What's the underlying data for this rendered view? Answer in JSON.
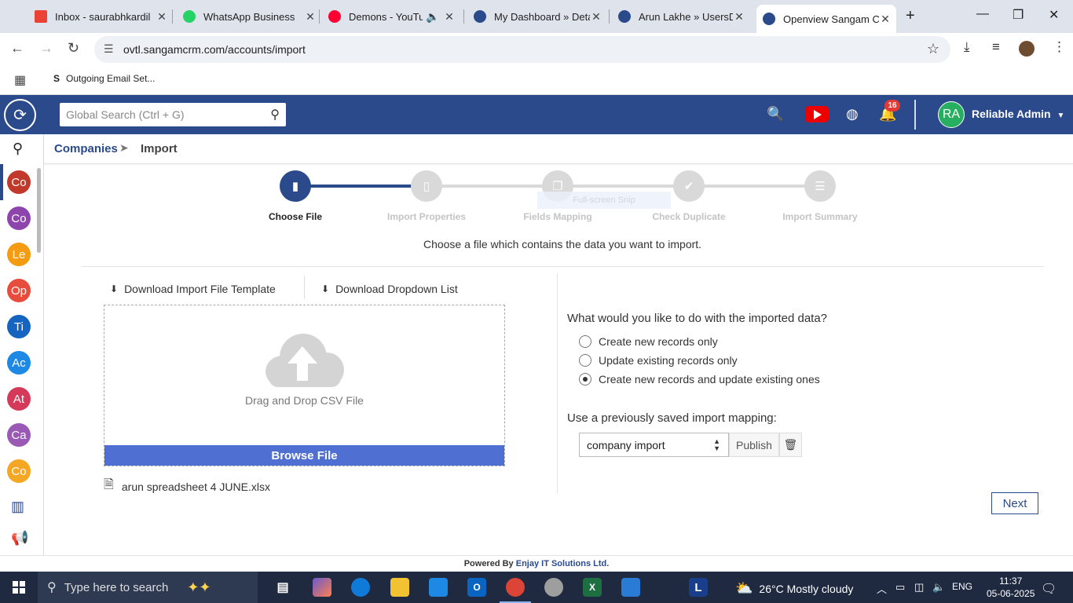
{
  "browser": {
    "tabs": [
      {
        "title": "Inbox - saurabhkardil",
        "color": "#ea4335",
        "icon": "gmail-icon"
      },
      {
        "title": "WhatsApp Business",
        "color": "#25d366",
        "icon": "whatsapp-icon"
      },
      {
        "title": "Demons - YouTube",
        "color": "#ff0033",
        "icon": "youtube-icon"
      },
      {
        "title": "My Dashboard » Deta",
        "color": "#2b4a8b",
        "icon": "crm-icon"
      },
      {
        "title": "Arun Lakhe » UsersDe",
        "color": "#2b4a8b",
        "icon": "crm-icon"
      },
      {
        "title": "Openview Sangam CR",
        "color": "#2b4a8b",
        "icon": "crm-icon"
      }
    ],
    "url": "ovtl.sangamcrm.com/accounts/import",
    "bookmark": "Outgoing Email Set..."
  },
  "header": {
    "search_placeholder": "Global Search (Ctrl + G)",
    "notification_count": "16",
    "avatar_initials": "RA",
    "user_name": "Reliable Admin"
  },
  "rail": [
    {
      "label": "Co",
      "color": "#c0392b"
    },
    {
      "label": "Co",
      "color": "#8e44ad"
    },
    {
      "label": "Le",
      "color": "#f39c12"
    },
    {
      "label": "Op",
      "color": "#e74c3c"
    },
    {
      "label": "Ti",
      "color": "#1565c0"
    },
    {
      "label": "Ac",
      "color": "#1e88e5"
    },
    {
      "label": "At",
      "color": "#d63a5a"
    },
    {
      "label": "Ca",
      "color": "#9b59b6"
    },
    {
      "label": "Co",
      "color": "#f5a623"
    }
  ],
  "breadcrumb": {
    "parent": "Companies",
    "current": "Import"
  },
  "stepper": {
    "steps": [
      "Choose File",
      "Import Properties",
      "Fields Mapping",
      "Check Duplicate",
      "Import Summary"
    ],
    "active_step": 1,
    "active_color": "#2b4a8b",
    "inactive_color": "#d9d9d9",
    "overlay_text": "Full-screen Snip"
  },
  "instruction": "Choose a file which contains the data you want to import.",
  "left": {
    "download_template": "Download Import File Template",
    "download_dropdown": "Download Dropdown List",
    "drop_text": "Drag and Drop CSV File",
    "browse_label": "Browse File",
    "file_name": "arun spreadsheet 4 JUNE.xlsx"
  },
  "right": {
    "question": "What would you like to do with the imported data?",
    "options": [
      {
        "label": "Create new records only",
        "selected": false
      },
      {
        "label": "Update existing records only",
        "selected": false
      },
      {
        "label": "Create new records and update existing ones",
        "selected": true
      }
    ],
    "mapping_label": "Use a previously saved import mapping:",
    "mapping_value": "company import",
    "publish_label": "Publish"
  },
  "next_label": "Next",
  "footer": {
    "prefix": "Powered By",
    "brand": "Enjay IT Solutions Ltd."
  },
  "taskbar": {
    "search_placeholder": "Type here to search",
    "weather": "26°C  Mostly cloudy",
    "language": "ENG",
    "time": "11:37",
    "date": "05-06-2025"
  }
}
